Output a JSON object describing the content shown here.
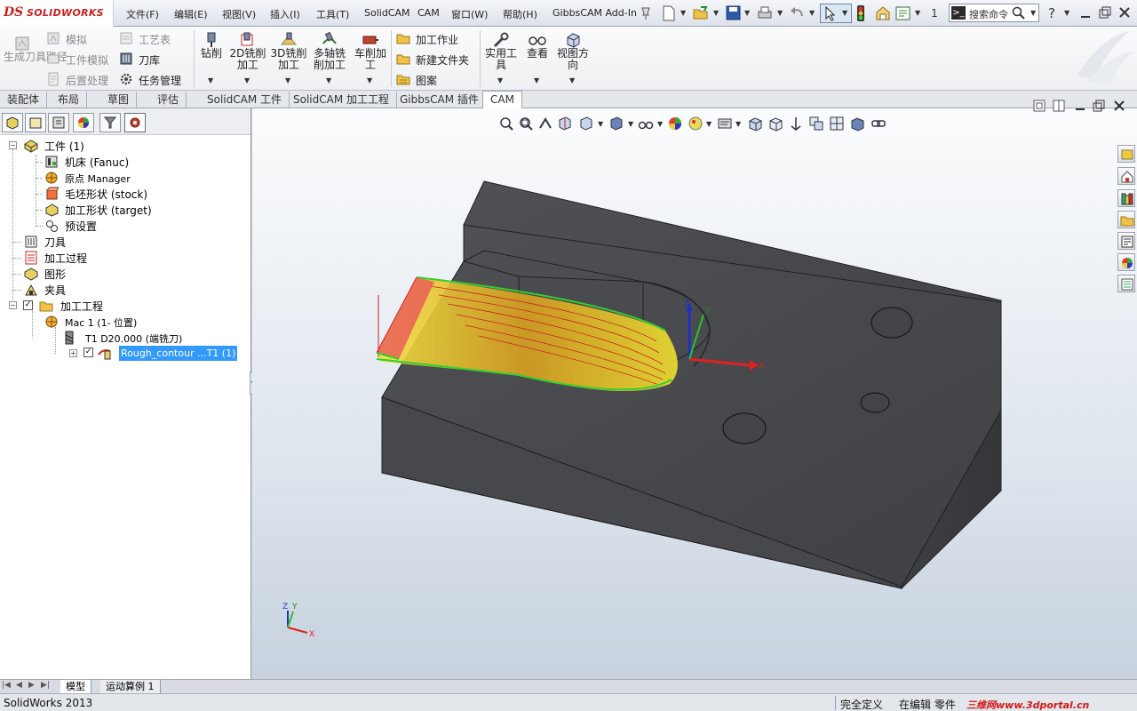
{
  "app": {
    "logo_prefix": "DS",
    "logo_name": "SOLIDWORKS",
    "status_app": "SolidWorks 2013"
  },
  "menus": [
    "文件(F)",
    "编辑(E)",
    "视图(V)",
    "插入(I)",
    "工具(T)",
    "SolidCAM",
    "CAM",
    "窗口(W)",
    "帮助(H)",
    "GibbsCAM Add-In"
  ],
  "quick": {
    "counter": "1",
    "search_placeholder": "搜索命令",
    "help": "?",
    "window_restore": "❐",
    "window_close": "✕"
  },
  "ribbon": {
    "left_big": "生成刀具路径",
    "col1": [
      "模拟",
      "工件模拟",
      "后置处理"
    ],
    "col2": [
      "工艺表",
      "刀库",
      "任务管理"
    ],
    "ops": [
      {
        "label": "钻削",
        "line2": ""
      },
      {
        "label": "2D铣削",
        "line2": "加工"
      },
      {
        "label": "3D铣削",
        "line2": "加工"
      },
      {
        "label": "多轴铣",
        "line2": "削加工"
      },
      {
        "label": "车削加",
        "line2": "工"
      }
    ],
    "col3": [
      "加工作业",
      "新建文件夹",
      "图案"
    ],
    "tools": [
      {
        "label": "实用工",
        "line2": "具"
      },
      {
        "label": "查看",
        "line2": ""
      },
      {
        "label": "视图方",
        "line2": "向"
      }
    ]
  },
  "tabs": [
    "装配体",
    "布局",
    "草图",
    "评估",
    "SolidCAM 工件",
    "SolidCAM 加工工程",
    "GibbsCAM 插件",
    "CAM"
  ],
  "active_tab": "CAM",
  "tree": {
    "root": "工件 (1)",
    "machine": "机床 (Fanuc)",
    "origin": "原点 Manager",
    "stock": "毛坯形状 (stock)",
    "target": "加工形状 (target)",
    "preset": "预设置",
    "tools": "刀具",
    "process": "加工过程",
    "geometry": "图形",
    "fixture": "夹具",
    "project": "加工工程",
    "mac": "Mac 1 (1- 位置)",
    "tool_t1": "T1  D20.000  (端铣刀)",
    "operation": "Rough_contour ...T1 (1)"
  },
  "bottom_tabs": [
    "模型",
    "运动算例 1"
  ],
  "status": {
    "define": "完全定义",
    "editing": "在编辑 零件",
    "watermark": "三维网www.3dportal.cn"
  },
  "triad": {
    "x": "X",
    "y": "Y",
    "z": "Z"
  },
  "colors": {
    "accent": "#3399ff",
    "brand": "#cc1f1f",
    "part": "#4a4b4f",
    "toolpath_red": "#e02020",
    "toolpath_yellow": "#f0e020",
    "toolpath_green": "#2fd02f"
  }
}
